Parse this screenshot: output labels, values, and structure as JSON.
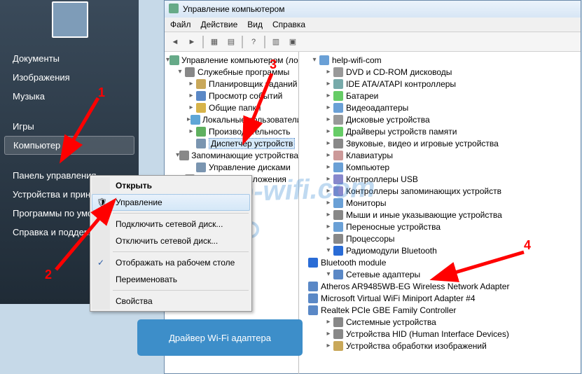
{
  "start_menu": {
    "user_name": "",
    "items": [
      {
        "label": "Документы"
      },
      {
        "label": "Изображения"
      },
      {
        "label": "Музыка"
      },
      {
        "label": "Игры"
      },
      {
        "label": "Компьютер"
      },
      {
        "label": "Панель управления"
      },
      {
        "label": "Устройства и принтеры"
      },
      {
        "label": "Программы по умолчанию"
      },
      {
        "label": "Справка и поддержка"
      }
    ]
  },
  "context_menu": {
    "items": [
      {
        "label": "Открыть",
        "bold": true
      },
      {
        "label": "Управление",
        "highlight": true
      },
      {
        "sep": true
      },
      {
        "label": "Подключить сетевой диск..."
      },
      {
        "label": "Отключить сетевой диск..."
      },
      {
        "sep": true
      },
      {
        "label": "Отображать на рабочем столе",
        "checked": true
      },
      {
        "label": "Переименовать"
      },
      {
        "sep": true
      },
      {
        "label": "Свойства"
      }
    ]
  },
  "mmc": {
    "title": "Управление компьютером",
    "menus": [
      "Файл",
      "Действие",
      "Вид",
      "Справка"
    ],
    "left_tree": [
      {
        "ind": 0,
        "exp": "▾",
        "icon": "#6a8",
        "label": "Управление компьютером (локальным)"
      },
      {
        "ind": 1,
        "exp": "▾",
        "icon": "#888",
        "label": "Служебные программы"
      },
      {
        "ind": 2,
        "exp": "▸",
        "icon": "#c9a85a",
        "label": "Планировщик заданий"
      },
      {
        "ind": 2,
        "exp": "▸",
        "icon": "#5a88c6",
        "label": "Просмотр событий"
      },
      {
        "ind": 2,
        "exp": "▸",
        "icon": "#d6b34a",
        "label": "Общие папки"
      },
      {
        "ind": 2,
        "exp": "▸",
        "icon": "#5fa6d6",
        "label": "Локальные пользователи"
      },
      {
        "ind": 2,
        "exp": "▸",
        "icon": "#5fb05f",
        "label": "Производительность"
      },
      {
        "ind": 2,
        "exp": "",
        "icon": "#7a95b0",
        "label": "Диспетчер устройств",
        "sel": true
      },
      {
        "ind": 1,
        "exp": "▾",
        "icon": "#888",
        "label": "Запоминающие устройства"
      },
      {
        "ind": 2,
        "exp": "",
        "icon": "#7a95b0",
        "label": "Управление дисками"
      },
      {
        "ind": 1,
        "exp": "▸",
        "icon": "#888",
        "label": "Службы и приложения"
      }
    ],
    "right_tree": [
      {
        "ind": 1,
        "exp": "▾",
        "icon": "#6aa0d6",
        "label": "help-wifi-com"
      },
      {
        "ind": 2,
        "exp": "▸",
        "icon": "#999",
        "label": "DVD и CD-ROM дисководы"
      },
      {
        "ind": 2,
        "exp": "▸",
        "icon": "#7aa",
        "label": "IDE ATA/ATAPI контроллеры"
      },
      {
        "ind": 2,
        "exp": "▸",
        "icon": "#6c6",
        "label": "Батареи"
      },
      {
        "ind": 2,
        "exp": "▸",
        "icon": "#6aa0d6",
        "label": "Видеоадаптеры"
      },
      {
        "ind": 2,
        "exp": "▸",
        "icon": "#999",
        "label": "Дисковые устройства"
      },
      {
        "ind": 2,
        "exp": "▸",
        "icon": "#6c6",
        "label": "Драйверы устройств памяти"
      },
      {
        "ind": 2,
        "exp": "▸",
        "icon": "#888",
        "label": "Звуковые, видео и игровые устройства"
      },
      {
        "ind": 2,
        "exp": "▸",
        "icon": "#c99",
        "label": "Клавиатуры"
      },
      {
        "ind": 2,
        "exp": "▸",
        "icon": "#6aa0d6",
        "label": "Компьютер"
      },
      {
        "ind": 2,
        "exp": "▸",
        "icon": "#88c",
        "label": "Контроллеры USB"
      },
      {
        "ind": 2,
        "exp": "▸",
        "icon": "#88c",
        "label": "Контроллеры запоминающих устройств"
      },
      {
        "ind": 2,
        "exp": "▸",
        "icon": "#6aa0d6",
        "label": "Мониторы"
      },
      {
        "ind": 2,
        "exp": "▸",
        "icon": "#888",
        "label": "Мыши и иные указывающие устройства"
      },
      {
        "ind": 2,
        "exp": "▸",
        "icon": "#6aa0d6",
        "label": "Переносные устройства"
      },
      {
        "ind": 2,
        "exp": "▸",
        "icon": "#888",
        "label": "Процессоры"
      },
      {
        "ind": 2,
        "exp": "▾",
        "icon": "#2a6cd6",
        "label": "Радиомодули Bluetooth"
      },
      {
        "ind": 3,
        "exp": "",
        "icon": "#2a6cd6",
        "label": "Bluetooth module"
      },
      {
        "ind": 2,
        "exp": "▾",
        "icon": "#5a88c6",
        "label": "Сетевые адаптеры"
      },
      {
        "ind": 3,
        "exp": "",
        "icon": "#5a88c6",
        "label": "Atheros AR9485WB-EG Wireless Network Adapter"
      },
      {
        "ind": 3,
        "exp": "",
        "icon": "#5a88c6",
        "label": "Microsoft Virtual WiFi Miniport Adapter #4"
      },
      {
        "ind": 3,
        "exp": "",
        "icon": "#5a88c6",
        "label": "Realtek PCIe GBE Family Controller"
      },
      {
        "ind": 2,
        "exp": "▸",
        "icon": "#888",
        "label": "Системные устройства"
      },
      {
        "ind": 2,
        "exp": "▸",
        "icon": "#888",
        "label": "Устройства HID (Human Interface Devices)"
      },
      {
        "ind": 2,
        "exp": "▸",
        "icon": "#c9a85a",
        "label": "Устройства обработки изображений"
      }
    ]
  },
  "callout": {
    "text": "Драйвер Wi-Fi адаптера"
  },
  "annotations": {
    "n1": "1",
    "n2": "2",
    "n3": "3",
    "n4": "4"
  },
  "watermark": "help-wifi.com"
}
